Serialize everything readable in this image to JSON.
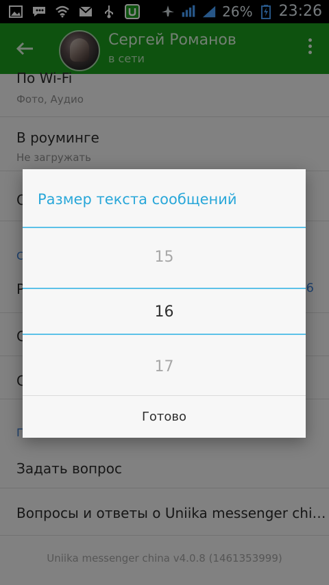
{
  "statusbar": {
    "battery_percent": "26%",
    "time": "23:26",
    "icons": [
      "image-icon",
      "chat-icon",
      "wifi-icon",
      "email-icon",
      "usb-icon",
      "app-u-icon",
      "airplane-icon",
      "data-signal-icon",
      "signal-bars-icon",
      "battery-charging-icon"
    ]
  },
  "header": {
    "contact_name": "Сергей Романов",
    "contact_status": "в сети"
  },
  "settings": {
    "wifi_title": "По Wi-Fi",
    "wifi_sub": "Фото, Аудио",
    "roaming_title": "В роуминге",
    "roaming_sub": "Не загружать",
    "partial_left_1": "О",
    "partial_left_2": "С",
    "partial_left_3": "Р",
    "partial_left_4": "С",
    "partial_left_5": "С",
    "partial_right_value": "6",
    "ask_question": "Задать вопрос",
    "faq": "Вопросы и ответы о Uniika messenger chi…",
    "section_partial": "П…",
    "version": "Uniika messenger china v4.0.8 (1461353999)"
  },
  "dialog": {
    "title": "Размер текста сообщений",
    "values": [
      "15",
      "16",
      "17"
    ],
    "selected": "16",
    "done": "Готово"
  }
}
